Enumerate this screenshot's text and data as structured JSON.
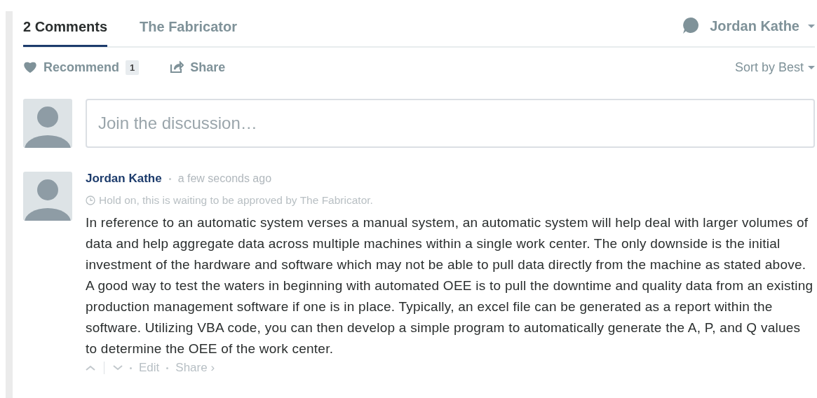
{
  "tabs": [
    {
      "label": "2 Comments",
      "selected": true
    },
    {
      "label": "The Fabricator",
      "selected": false
    }
  ],
  "user_menu": {
    "label": "Jordan Kathe"
  },
  "actions": {
    "recommend": {
      "label": "Recommend",
      "count": "1"
    },
    "share": {
      "label": "Share"
    },
    "sort": {
      "label": "Sort by Best"
    }
  },
  "composer": {
    "placeholder": "Join the discussion…"
  },
  "comments": [
    {
      "author": "Jordan Kathe",
      "time": "a few seconds ago",
      "pending_note": "Hold on, this is waiting to be approved by The Fabricator.",
      "body": "In reference to an automatic system verses a manual system, an automatic system will help deal with larger volumes of data and help aggregate data across multiple machines within a single work center. The only downside is the initial investment of the hardware and software which may not be able to pull data directly from the machine as stated above. A good way to test the waters in beginning with automated OEE is to pull the downtime and quality data from an existing production management software if one is in place. Typically, an excel file can be generated as a report within the software. Utilizing VBA code, you can then develop a simple program to automatically generate the A, P, and Q values to determine the OEE of the work center.",
      "footer_links": [
        "Edit",
        "Share ›"
      ]
    }
  ]
}
